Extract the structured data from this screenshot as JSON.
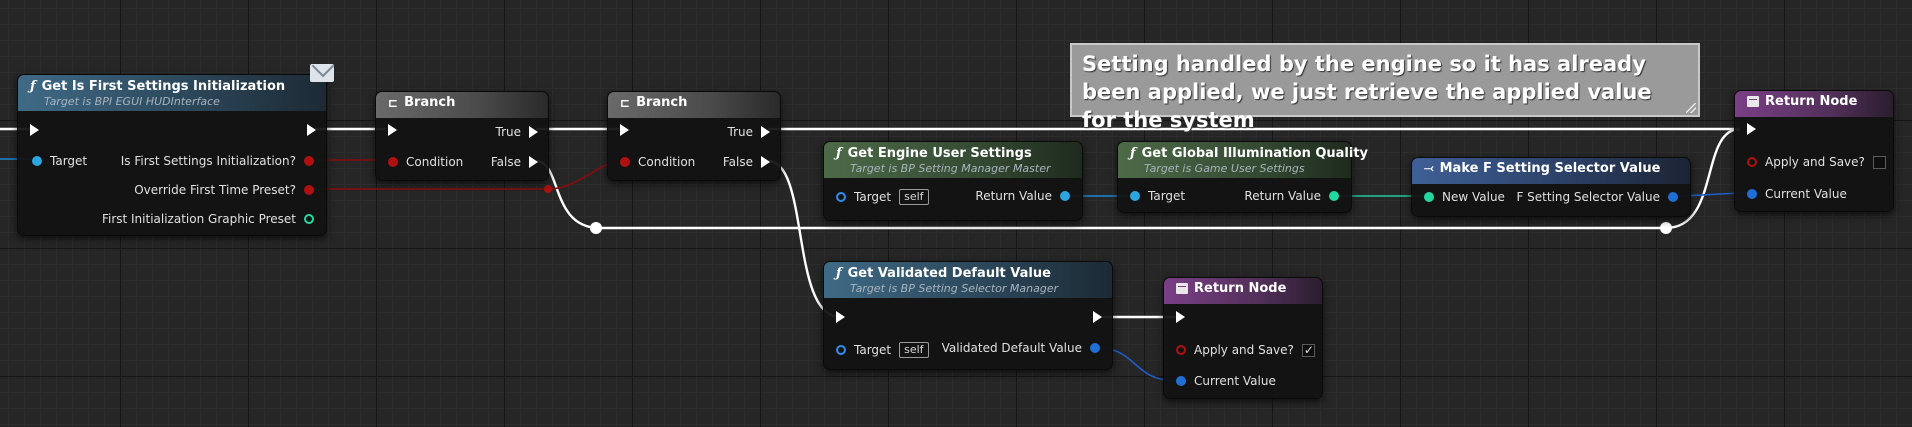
{
  "comment": {
    "text": "Setting handled by the engine so it has already been applied, we just retrieve the applied value for the system"
  },
  "nodes": {
    "first_settings": {
      "title": "Get Is First Settings Initialization",
      "subtitle": "Target is BPI EGUI HUDInterface",
      "target_label": "Target",
      "is_first_label": "Is First Settings Initialization?",
      "override_label": "Override First Time Preset?",
      "graphic_preset_label": "First Initialization Graphic Preset"
    },
    "branch1": {
      "title": "Branch",
      "true_label": "True",
      "false_label": "False",
      "condition_label": "Condition"
    },
    "branch2": {
      "title": "Branch",
      "true_label": "True",
      "false_label": "False",
      "condition_label": "Condition"
    },
    "engine_settings": {
      "title": "Get Engine User Settings",
      "subtitle": "Target is BP Setting Manager Master",
      "target_label": "Target",
      "self_label": "self",
      "return_label": "Return Value"
    },
    "gi_quality": {
      "title": "Get Global Illumination Quality",
      "subtitle": "Target is Game User Settings",
      "target_label": "Target",
      "return_label": "Return Value"
    },
    "make_selector": {
      "title": "Make F Setting Selector Value",
      "new_value_label": "New Value",
      "out_label": "F Setting Selector Value"
    },
    "return_top": {
      "title": "Return Node",
      "apply_label": "Apply and Save?",
      "apply_checked": false,
      "current_label": "Current Value"
    },
    "validated_default": {
      "title": "Get Validated Default Value",
      "subtitle": "Target is BP Setting Selector Manager",
      "target_label": "Target",
      "self_label": "self",
      "out_label": "Validated Default Value"
    },
    "return_bottom": {
      "title": "Return Node",
      "apply_label": "Apply and Save?",
      "apply_checked": true,
      "current_label": "Current Value"
    }
  },
  "icons": {
    "function": "function-icon",
    "branch": "branch-icon",
    "return": "return-node-icon",
    "make_struct": "make-struct-icon",
    "message": "envelope-icon"
  },
  "colors": {
    "exec_wire": "#ffffff",
    "bool_pin": "#b01010",
    "object_pin": "#2f8cf0",
    "enum_pin": "#20d8a0",
    "struct_pin": "#1f6fd6",
    "comment_bg": "#9a9a9a"
  }
}
